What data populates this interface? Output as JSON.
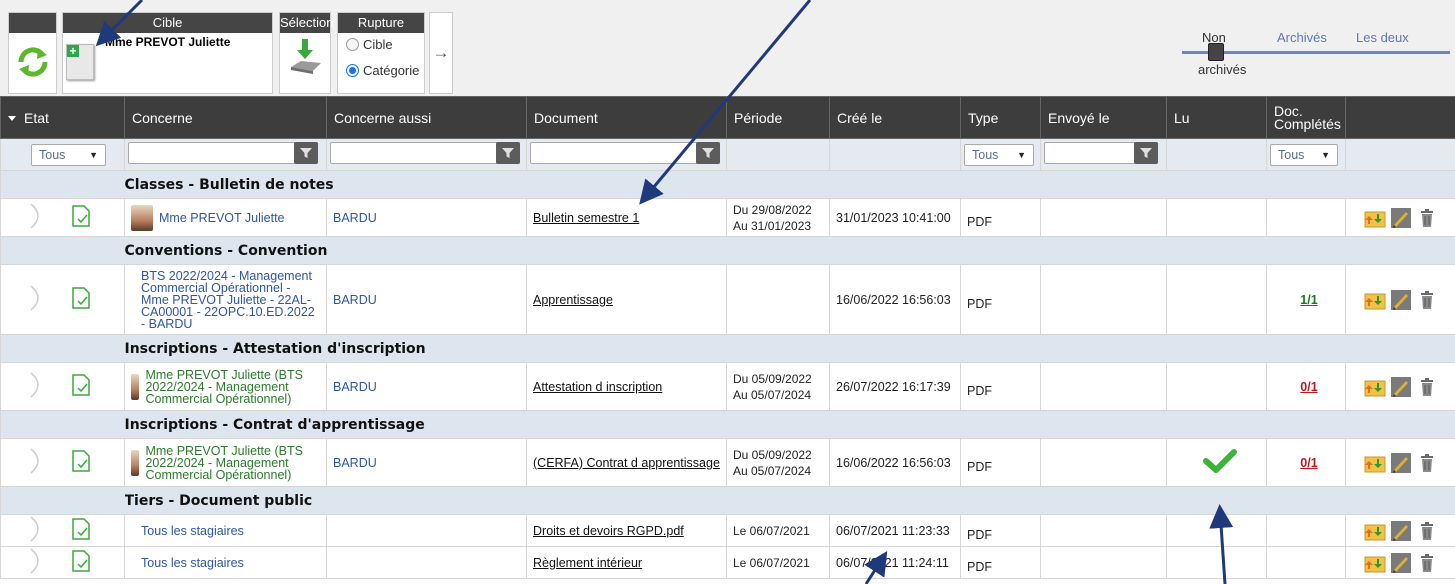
{
  "toolbar": {
    "cible_title": "Cible",
    "target_name": "Mme PREVOT Juliette",
    "selection_title": "Sélection",
    "rupture_title": "Rupture",
    "radio_cible": "Cible",
    "radio_categorie": "Catégorie",
    "rupture_selected": "Catégorie",
    "next_icon": "arrow-right"
  },
  "archive_switch": {
    "non": "Non",
    "archives_label": "archivés",
    "archives": "Archivés",
    "both": "Les deux"
  },
  "headers": {
    "etat": "Etat",
    "concerne": "Concerne",
    "concerne_aussi": "Concerne aussi",
    "document": "Document",
    "periode": "Période",
    "cree_le": "Créé le",
    "type": "Type",
    "envoye_le": "Envoyé le",
    "lu": "Lu",
    "doc_completes": "Doc. Complétés"
  },
  "filters": {
    "etat": "Tous",
    "type": "Tous",
    "doc_completes": "Tous"
  },
  "groups": [
    {
      "title": "Classes  - Bulletin de notes",
      "rows": [
        {
          "concerne": "Mme PREVOT Juliette",
          "concerne_style": "blue",
          "avatar": true,
          "concerne_aussi": "BARDU",
          "document": "Bulletin semestre 1",
          "periode": "Du 29/08/2022\nAu 31/01/2023",
          "cree_le": "31/01/2023 10:41:00",
          "type": "PDF",
          "lu": "",
          "completes": "",
          "completes_color": ""
        }
      ]
    },
    {
      "title": "Conventions  - Convention",
      "rows": [
        {
          "concerne": "BTS 2022/2024 - Management Commercial Opérationnel - Mme PREVOT Juliette - 22AL-CA00001 - 22OPC.10.ED.2022 - BARDU",
          "concerne_style": "blue",
          "avatar": false,
          "concerne_aussi": "BARDU",
          "document": "Apprentissage",
          "periode": "",
          "cree_le": "16/06/2022 16:56:03",
          "type": "PDF",
          "lu": "",
          "completes": "1/1",
          "completes_color": "green"
        }
      ]
    },
    {
      "title": "Inscriptions  - Attestation d'inscription",
      "rows": [
        {
          "concerne": "Mme PREVOT Juliette (BTS 2022/2024 - Management Commercial Opérationnel)",
          "concerne_style": "green",
          "avatar": true,
          "concerne_aussi": "BARDU",
          "document": "Attestation d inscription",
          "periode": "Du 05/09/2022\nAu 05/07/2024",
          "cree_le": "26/07/2022 16:17:39",
          "type": "PDF",
          "lu": "",
          "completes": "0/1",
          "completes_color": "red"
        }
      ]
    },
    {
      "title": "Inscriptions  - Contrat d'apprentissage",
      "rows": [
        {
          "concerne": "Mme PREVOT Juliette (BTS 2022/2024 - Management Commercial Opérationnel)",
          "concerne_style": "green",
          "avatar": true,
          "concerne_aussi": "BARDU",
          "document": "(CERFA) Contrat d apprentissage",
          "periode": "Du 05/09/2022\nAu 05/07/2024",
          "cree_le": "16/06/2022 16:56:03",
          "type": "PDF",
          "lu": "check",
          "completes": "0/1",
          "completes_color": "red"
        }
      ]
    },
    {
      "title": "Tiers  - Document public",
      "rows": [
        {
          "concerne": "Tous les stagiaires",
          "concerne_style": "blue",
          "avatar": false,
          "concerne_aussi": "",
          "document": "Droits et devoirs RGPD.pdf",
          "periode": "Le 06/07/2021",
          "cree_le": "06/07/2021 11:23:33",
          "type": "PDF",
          "lu": "",
          "completes": "",
          "completes_color": ""
        },
        {
          "concerne": "Tous les stagiaires",
          "concerne_style": "blue",
          "avatar": false,
          "concerne_aussi": "",
          "document": "Règlement intérieur",
          "periode": "Le 06/07/2021",
          "cree_le": "06/07/2021 11:24:11",
          "type": "PDF",
          "lu": "",
          "completes": "",
          "completes_color": ""
        }
      ]
    }
  ],
  "colors": {
    "header_bg": "#3d3d3d",
    "group_bg": "#dde5ee",
    "filter_bg": "#e5eaf1",
    "link_blue": "#2e55a8",
    "green_text": "#2d7a2d",
    "complete_green": "#1a7a1a",
    "complete_red": "#c01818",
    "check": "#3cb43c",
    "annotation_arrow": "#1f3a7a"
  }
}
